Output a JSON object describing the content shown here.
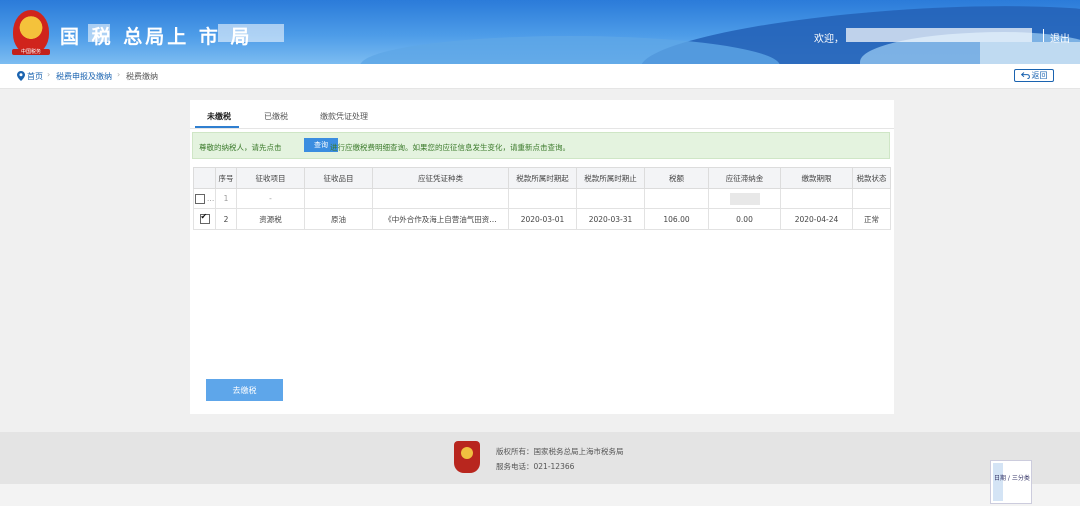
{
  "header": {
    "title": "国 税 总局上 市 局",
    "emblem_caption": "中国税务",
    "welcome": "欢迎，",
    "logout": "退出"
  },
  "breadcrumb": {
    "items": [
      "首页",
      "税费申报及缴纳",
      "税费缴纳"
    ],
    "back": "返回"
  },
  "tabs": [
    "未缴税",
    "已缴税",
    "缴款凭证处理"
  ],
  "notice": {
    "prefix": "尊敬的纳税人，请先点击",
    "button": "查询",
    "suffix": "进行应缴税费明细查询。如果您的应征信息发生变化，请重新点击查询。"
  },
  "table": {
    "columns": [
      "序号",
      "征收项目",
      "征收品目",
      "应征凭证种类",
      "税款所属时期起",
      "税款所属时期止",
      "税额",
      "应征滞纳金",
      "缴款期限",
      "税款状态"
    ],
    "rows": [
      {
        "checked": false,
        "cells": [
          "1",
          "-",
          "",
          "",
          "",
          "",
          "",
          "",
          "",
          ""
        ]
      },
      {
        "checked": true,
        "cells": [
          "2",
          "资源税",
          "原油",
          "《中外合作及海上自营油气田资…",
          "2020-03-01",
          "2020-03-31",
          "106.00",
          "0.00",
          "2020-04-24",
          "正常"
        ]
      }
    ]
  },
  "pay_button": "去缴税",
  "footer": {
    "copyright": "版权所有：国家税务总局上海市税务局",
    "phone": "服务电话：021-12366"
  },
  "widget": {
    "text": "日期 / 三分类"
  },
  "colors": {
    "accent": "#2f7fd0",
    "header": "#2b7bd9",
    "notice_bg": "#e4f3df"
  }
}
